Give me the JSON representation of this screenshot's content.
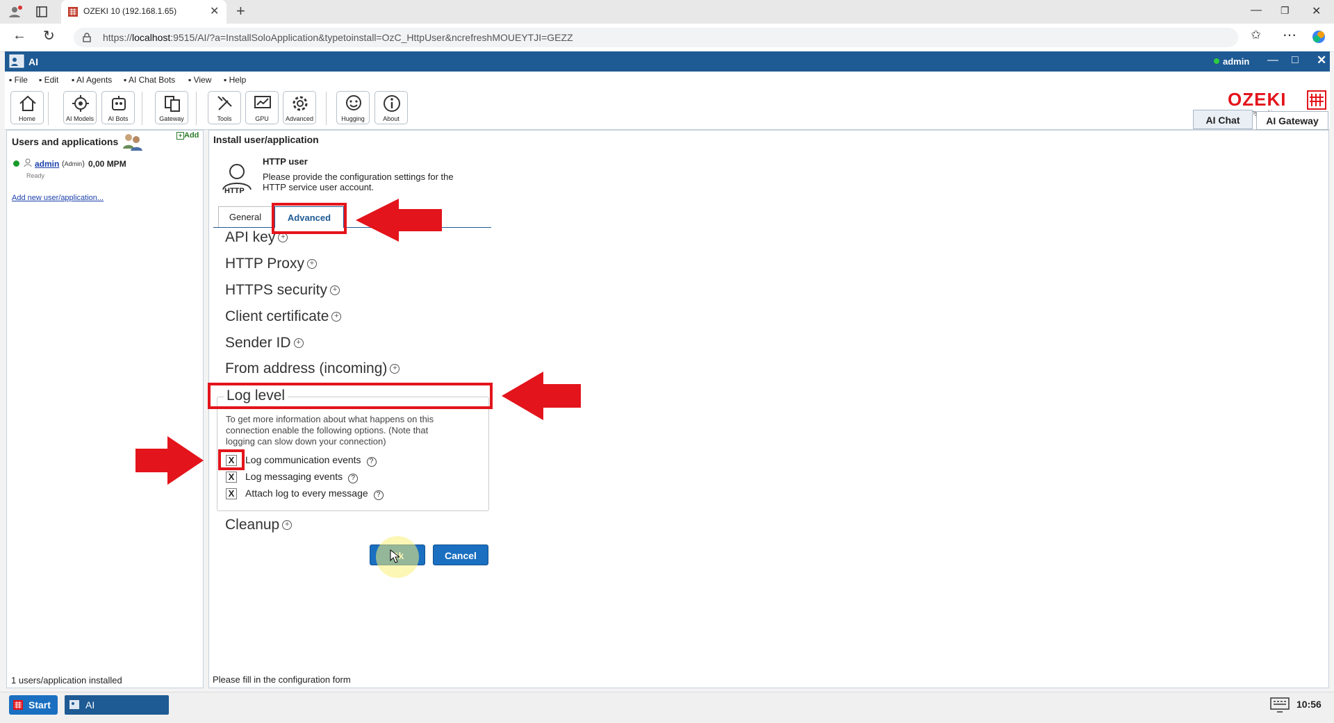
{
  "browser": {
    "tab_title": "OZEKI 10 (192.168.1.65)",
    "url_prefix": "https://",
    "url_host": "localhost",
    "url_rest": ":9515/AI/?a=InstallSoloApplication&typetoinstall=OzC_HttpUser&ncrefreshMOUEYTJI=GEZZ"
  },
  "app": {
    "title": "AI",
    "user": "admin",
    "menu": [
      "File",
      "Edit",
      "AI Agents",
      "AI Chat Bots",
      "View",
      "Help"
    ],
    "toolbar": [
      "Home",
      "AI Models",
      "AI Bots",
      "Gateway",
      "Tools",
      "GPU",
      "Advanced",
      "Hugging",
      "About"
    ],
    "brand": "OZEKI",
    "brand_url": "www.myozeki.com",
    "right_tabs": [
      "AI Chat",
      "AI Gateway"
    ]
  },
  "left": {
    "title": "Users and applications",
    "add": "Add",
    "user_name": "admin",
    "user_role": "Admin",
    "user_rate": "0,00 MPM",
    "user_status": "Ready",
    "add_link": "Add new user/application...",
    "footer": "1 users/application installed"
  },
  "main": {
    "title": "Install user/application",
    "heading": "HTTP user",
    "desc_line1": "Please provide the configuration settings for the",
    "desc_line2": "HTTP service user account.",
    "icon_label": "HTTP",
    "tabs": [
      "General",
      "Advanced"
    ],
    "sections": [
      "API key",
      "HTTP Proxy",
      "HTTPS security",
      "Client certificate",
      "Sender ID",
      "From address (incoming)"
    ],
    "log_level": "Log level",
    "log_desc1": "To get more information about what happens on this",
    "log_desc2": "connection enable the following options. (Note that",
    "log_desc3": "logging can slow down your connection)",
    "checkbox_mark": "X",
    "checkboxes": [
      "Log communication events",
      "Log messaging events",
      "Attach log to every message"
    ],
    "cleanup": "Cleanup",
    "ok": "Ok",
    "cancel": "Cancel",
    "footer": "Please fill in the configuration form"
  },
  "taskbar": {
    "start": "Start",
    "app": "AI",
    "time": "10:56"
  },
  "colors": {
    "title_bar": "#1e5a94",
    "button": "#1a6fc0",
    "highlight": "#e3141b"
  }
}
